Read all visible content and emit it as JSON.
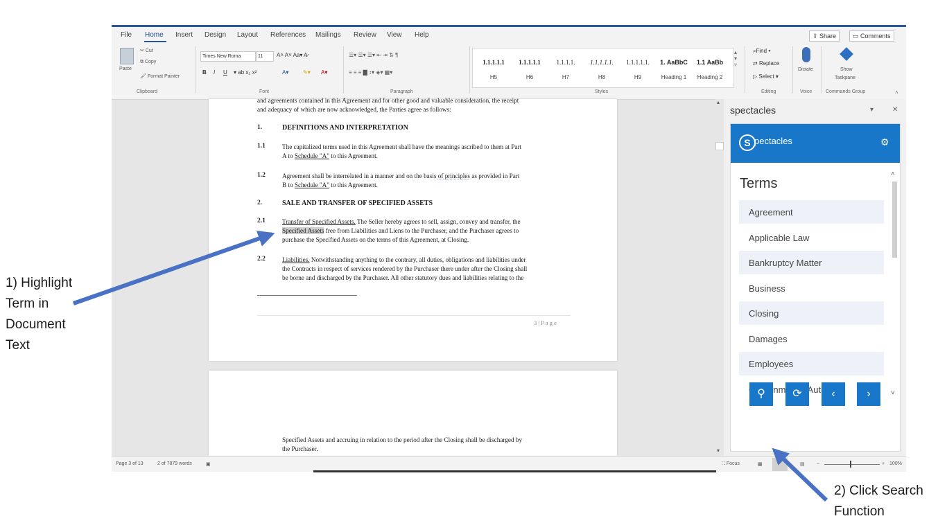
{
  "menu": [
    "File",
    "Home",
    "Insert",
    "Design",
    "Layout",
    "References",
    "Mailings",
    "Review",
    "View",
    "Help"
  ],
  "top_buttons": {
    "share": "Share",
    "comments": "Comments"
  },
  "ribbon": {
    "clipboard": {
      "paste": "Paste",
      "cut": "Cut",
      "copy": "Copy",
      "format_painter": "Format Painter",
      "label": "Clipboard"
    },
    "font": {
      "font_name": "Times New Roma",
      "font_size": "11",
      "label": "Font"
    },
    "paragraph": {
      "label": "Paragraph"
    },
    "styles": {
      "items": [
        {
          "sample": "1.1.1.1.1",
          "name": "H5"
        },
        {
          "sample": "1.1.1.1.1",
          "name": "H6"
        },
        {
          "sample": "1.1.1.1.",
          "name": "H7"
        },
        {
          "sample": "1.1.1.1.1.",
          "name": "H8"
        },
        {
          "sample": "1.1.1.1.1.",
          "name": "H9"
        },
        {
          "sample": "1. AaBbC",
          "name": "Heading 1"
        },
        {
          "sample": "1.1 AaBb",
          "name": "Heading 2"
        }
      ],
      "label": "Styles"
    },
    "editing": {
      "find": "Find",
      "replace": "Replace",
      "select": "Select",
      "label": "Editing"
    },
    "voice": {
      "dictate": "Dictate",
      "label": "Voice"
    },
    "commands": {
      "show": "Show",
      "taskpane": "Taskpane",
      "label": "Commands Group"
    }
  },
  "document": {
    "intro_line1": "and agreements contained in this Agreement and for other good and valuable consideration, the receipt",
    "intro_line2": "and adequacy of which are now acknowledged, the Parties agree as follows:",
    "sec1_num": "1.",
    "sec1_title": "DEFINITIONS AND INTERPRETATION",
    "p11_num": "1.1",
    "p11_line1": "The capitalized terms used in this Agreement shall have the meanings ascribed to them at Part",
    "p11_line2a": "A to ",
    "p11_link": "Schedule \"A\"",
    "p11_line2b": " to this Agreement.",
    "p12_num": "1.2",
    "p12_line1a": "Agreement shall be interrelated in a manner and on the basis ",
    "p12_line1b": "of principles",
    "p12_line1c": " as provided in  Part",
    "p12_line2a": "B to ",
    "p12_link": "Schedule \"A\"",
    "p12_line2b": " to this Agreement.",
    "sec2_num": "2.",
    "sec2_title": "SALE AND TRANSFER OF SPECIFIED ASSETS",
    "p21_num": "2.1",
    "p21_line1a": "Transfer of Specified Assets.",
    "p21_line1b": "  The Seller hereby agrees to sell, assign, convey and transfer, the",
    "p21_line2a": "Specified Assets",
    "p21_line2b": " free from Liabilities and Liens to the Purchaser, and the Purchaser agrees to",
    "p21_line3": "purchase the Specified Assets on the terms of this Agreement, at Closing.",
    "p22_num": "2.2",
    "p22_line1a": "Liabilities.",
    "p22_line1b": " Notwithstanding anything to the contrary, all duties, obligations and liabilities under",
    "p22_line2": "the Contracts in respect of services rendered by the Purchaser there under after the Closing shall",
    "p22_line3": "be borne and discharged by the Purchaser. All other statutory dues and liabilities relating to the",
    "page_footer": "3 | P a g e",
    "page2_line1": "Specified Assets and accruing in relation to the period after the Closing shall be discharged by",
    "page2_line2": "the Purchaser."
  },
  "status": {
    "page": "Page 3 of 13",
    "words": "2 of 7879 words",
    "focus": "Focus",
    "zoom": "100%"
  },
  "taskpane": {
    "title": "spectacles",
    "brand_letter": "S",
    "brand_rest": "pectacles",
    "terms_heading": "Terms",
    "terms": [
      "Agreement",
      "Applicable Law",
      "Bankruptcy Matter",
      "Business",
      "Closing",
      "Damages",
      "Employees",
      "Governmental Authority"
    ],
    "buttons": [
      "search",
      "refresh",
      "previous",
      "next"
    ]
  },
  "annotations": {
    "step1": [
      "1)  Highlight",
      "Term in",
      "Document",
      "Text"
    ],
    "step2": [
      "2)  Click Search",
      "Function"
    ]
  },
  "colors": {
    "brand": "#1877c9",
    "accent_word": "#2b579a",
    "arrow": "#4a72c4"
  }
}
